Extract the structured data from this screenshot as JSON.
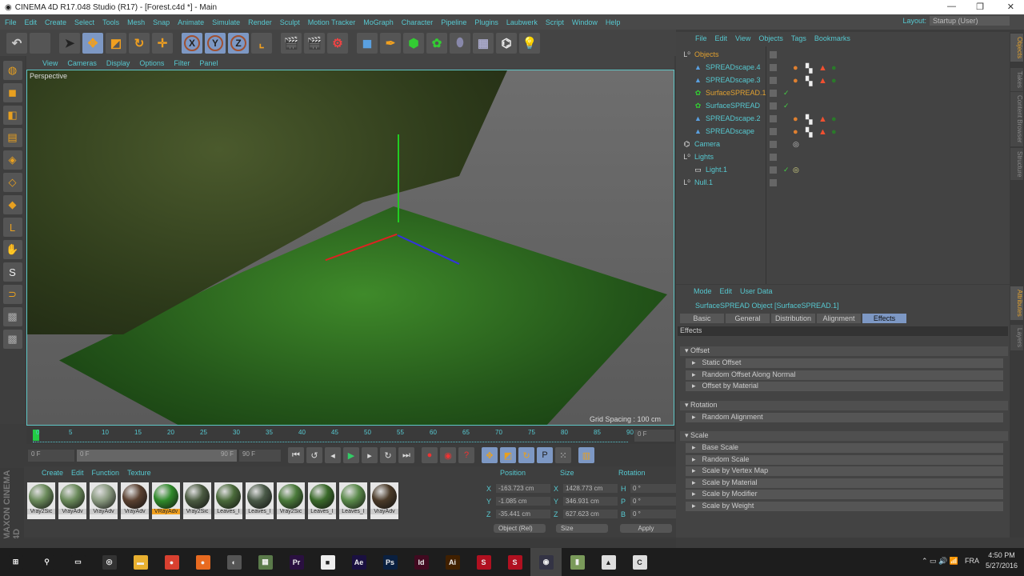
{
  "window": {
    "title": "CINEMA 4D R17.048 Studio (R17) - [Forest.c4d *] - Main",
    "minimize": "—",
    "restore": "❐",
    "close": "✕"
  },
  "menu": [
    "File",
    "Edit",
    "Create",
    "Select",
    "Tools",
    "Mesh",
    "Snap",
    "Animate",
    "Simulate",
    "Render",
    "Sculpt",
    "Motion Tracker",
    "MoGraph",
    "Character",
    "Pipeline",
    "Plugins",
    "Laubwerk",
    "Script",
    "Window",
    "Help"
  ],
  "layout": {
    "label": "Layout:",
    "value": "Startup (User)"
  },
  "viewport": {
    "menu": [
      "View",
      "Cameras",
      "Display",
      "Options",
      "Filter",
      "Panel"
    ],
    "label": "Perspective",
    "grid_spacing": "Grid Spacing : 100 cm"
  },
  "timeline": {
    "ticks": [
      "0",
      "5",
      "10",
      "15",
      "20",
      "25",
      "30",
      "35",
      "40",
      "45",
      "50",
      "55",
      "60",
      "65",
      "70",
      "75",
      "80",
      "85",
      "90"
    ],
    "current": "0 F",
    "start": "0 F",
    "range_start": "0 F",
    "range_end": "90 F",
    "end": "90 F"
  },
  "materials": {
    "menu": [
      "Create",
      "Edit",
      "Function",
      "Texture"
    ],
    "items": [
      {
        "name": "Vray2Sic",
        "color": "#6a8a5a"
      },
      {
        "name": "VrayAdv",
        "color": "#6a8a5a"
      },
      {
        "name": "VrayAdv",
        "color": "#8a9a80"
      },
      {
        "name": "VrayAdv",
        "color": "#5a4030"
      },
      {
        "name": "VRayAdv",
        "color": "#2f8a2a"
      },
      {
        "name": "Vray2Sic",
        "color": "#4a5a40"
      },
      {
        "name": "Leaves_I",
        "color": "#4a6a3a"
      },
      {
        "name": "Leaves_I",
        "color": "#4a5a48"
      },
      {
        "name": "Vray2Sic",
        "color": "#4a7a3a"
      },
      {
        "name": "Leaves_I",
        "color": "#3a6a2a"
      },
      {
        "name": "Leaves_I",
        "color": "#5a8a4a"
      },
      {
        "name": "VrayAdv",
        "color": "#4a3a28"
      }
    ],
    "selected_index": 4
  },
  "coords": {
    "headers": [
      "Position",
      "Size",
      "Rotation"
    ],
    "position": {
      "X": "-163.723 cm",
      "Y": "-1.085 cm",
      "Z": "-35.441 cm"
    },
    "size": {
      "X": "1428.773 cm",
      "Y": "346.931 cm",
      "Z": "627.623 cm"
    },
    "rotation": {
      "H": "0 °",
      "P": "0 °",
      "B": "0 °"
    },
    "mode": "Object (Rel)",
    "size_mode": "Size",
    "apply": "Apply"
  },
  "objects": {
    "menu": [
      "File",
      "Edit",
      "View",
      "Objects",
      "Tags",
      "Bookmarks"
    ],
    "items": [
      {
        "name": "Objects",
        "indent": 0,
        "icon": "null",
        "hl": true
      },
      {
        "name": "SPREADscape.4",
        "indent": 1,
        "icon": "spread",
        "tags": true
      },
      {
        "name": "SPREADscape.3",
        "indent": 1,
        "icon": "spread",
        "tags": true
      },
      {
        "name": "SurfaceSPREAD.1",
        "indent": 1,
        "icon": "surface",
        "check": true,
        "hl": true
      },
      {
        "name": "SurfaceSPREAD",
        "indent": 1,
        "icon": "surface",
        "check": true
      },
      {
        "name": "SPREADscape.2",
        "indent": 1,
        "icon": "spread",
        "tags": true
      },
      {
        "name": "SPREADscape",
        "indent": 1,
        "icon": "spread",
        "tags": true
      },
      {
        "name": "Camera",
        "indent": 0,
        "icon": "camera",
        "camtag": true
      },
      {
        "name": "Lights",
        "indent": 0,
        "icon": "null"
      },
      {
        "name": "Light.1",
        "indent": 1,
        "icon": "light",
        "check": true,
        "lighttag": true
      },
      {
        "name": "Null.1",
        "indent": 0,
        "icon": "null"
      }
    ]
  },
  "attributes": {
    "menu": [
      "Mode",
      "Edit",
      "User Data"
    ],
    "title": "SurfaceSPREAD Object [SurfaceSPREAD.1]",
    "tabs": [
      "Basic",
      "General",
      "Distribution",
      "Alignment",
      "Effects"
    ],
    "active_tab": "Effects",
    "section": "Effects",
    "groups": [
      {
        "name": "Offset",
        "items": [
          "Static Offset",
          "Random Offset Along Normal",
          "Offset by Material"
        ]
      },
      {
        "name": "Rotation",
        "items": [
          "Random Alignment"
        ]
      },
      {
        "name": "Scale",
        "items": [
          "Base Scale",
          "Random Scale",
          "Scale by Vertex Map",
          "Scale by Material",
          "Scale by Modifier",
          "Scale by Weight"
        ]
      }
    ]
  },
  "right_tabs": [
    "Objects",
    "Takes",
    "Content Browser",
    "Structure"
  ],
  "attr_tabs": [
    "Attributes",
    "Layers"
  ],
  "maxon_logo": "MAXON CINEMA 4D",
  "taskbar": {
    "apps": [
      {
        "l": "⊞",
        "c": "#1d1d1d"
      },
      {
        "l": "⚲",
        "c": "#1d1d1d"
      },
      {
        "l": "▭",
        "c": "#1d1d1d"
      },
      {
        "l": "◎",
        "c": "#333"
      },
      {
        "l": "▬",
        "c": "#e8b030"
      },
      {
        "l": "●",
        "c": "#d84030"
      },
      {
        "l": "●",
        "c": "#e86a20"
      },
      {
        "l": "◐",
        "c": "#555"
      },
      {
        "l": "▦",
        "c": "#5a7a4a"
      },
      {
        "l": "Pr",
        "c": "#2a1040"
      },
      {
        "l": "■",
        "c": "#eee"
      },
      {
        "l": "Ae",
        "c": "#1a1040"
      },
      {
        "l": "Ps",
        "c": "#0a2040"
      },
      {
        "l": "Id",
        "c": "#400a20"
      },
      {
        "l": "Ai",
        "c": "#402000"
      },
      {
        "l": "S",
        "c": "#b01020"
      },
      {
        "l": "S",
        "c": "#b01020"
      },
      {
        "l": "◉",
        "c": "#334"
      },
      {
        "l": "▮",
        "c": "#7a9a5a"
      },
      {
        "l": "▲",
        "c": "#ddd"
      },
      {
        "l": "C",
        "c": "#ddd"
      }
    ],
    "lang": "FRA",
    "time": "4:50 PM",
    "date": "5/27/2016"
  }
}
